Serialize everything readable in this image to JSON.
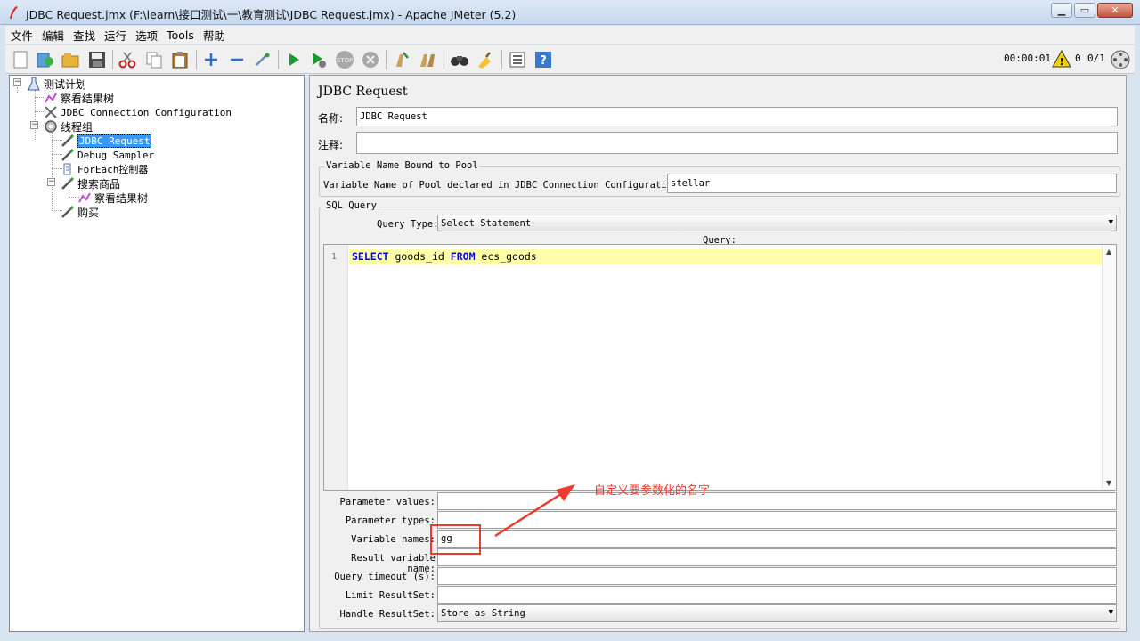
{
  "window": {
    "title": "JDBC Request.jmx (F:\\learn\\接口测试\\一\\教育测试\\JDBC Request.jmx) - Apache JMeter (5.2)",
    "minimize": "▁",
    "maximize": "▭",
    "close": "✕"
  },
  "menu": {
    "file": "文件",
    "edit": "编辑",
    "search": "查找",
    "run": "运行",
    "options": "选项",
    "tools": "Tools",
    "help": "帮助"
  },
  "toolbar": {
    "timer": "00:00:01",
    "warnings": "0",
    "threads": "0/1"
  },
  "tree": {
    "test_plan": "测试计划",
    "view_results_tree": "察看结果树",
    "jdbc_connection_configuration": "JDBC Connection Configuration",
    "thread_group": "线程组",
    "jdbc_request": "JDBC Request",
    "debug_sampler": "Debug Sampler",
    "foreach_controller": "ForEach控制器",
    "search_goods": "搜索商品",
    "search_goods_results_tree": "察看结果树",
    "buy": "购买"
  },
  "panel": {
    "title": "JDBC Request",
    "name_label": "名称:",
    "name_value": "JDBC Request",
    "comments_label": "注释:",
    "comments_value": "",
    "pool_group_legend": "Variable Name Bound to Pool",
    "pool_label": "Variable Name of Pool declared in JDBC Connection Configuration:",
    "pool_value": "stellar",
    "sql_group_legend": "SQL Query",
    "query_type_label": "Query Type:",
    "query_type_value": "Select Statement",
    "query_label": "Query:",
    "line_number": "1",
    "query_kw_select": "SELECT",
    "query_part_1": " goods_id ",
    "query_kw_from": "FROM",
    "query_part_2": " ecs_goods"
  },
  "params": {
    "parameter_values_label": "Parameter values:",
    "parameter_values": "",
    "parameter_types_label": "Parameter types:",
    "parameter_types": "",
    "variable_names_label": "Variable names:",
    "variable_names": "gg",
    "result_variable_name_label": "Result variable name:",
    "result_variable_name": "",
    "query_timeout_label": "Query timeout (s):",
    "query_timeout": "",
    "limit_resultset_label": "Limit ResultSet:",
    "limit_resultset": "",
    "handle_resultset_label": "Handle ResultSet:",
    "handle_resultset": "Store as String"
  },
  "annotation": {
    "text": "自定义要参数化的名字",
    "color": "#ef3b2d"
  },
  "colors": {
    "selection": "#3399ff",
    "sql_keyword": "#0000ff",
    "current_line": "#ffffaa"
  }
}
